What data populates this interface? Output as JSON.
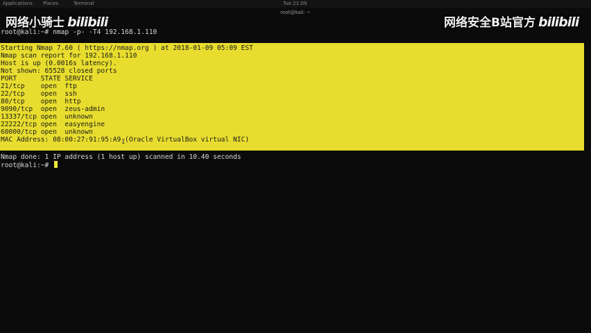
{
  "topbar": {
    "applications": "Applications",
    "places": "Places",
    "terminal": "Terminal",
    "clock": "Tue 21:09",
    "title": "root@kali: ~"
  },
  "watermarks": {
    "left_text": "网络小骑士",
    "left_logo": "bilibili",
    "right_text": "网络安全B站官方",
    "right_logo": "bilibili"
  },
  "terminal": {
    "prompt_command": "root@kali:~# nmap -p- -T4 192.168.1.110",
    "output": [
      "Starting Nmap 7.60 ( https://nmap.org ) at 2018-01-09 05:09 EST",
      "Nmap scan report for 192.168.1.110",
      "Host is up (0.0016s latency).",
      "Not shown: 65528 closed ports",
      "PORT      STATE SERVICE",
      "21/tcp    open  ftp",
      "22/tcp    open  ssh",
      "80/tcp    open  http",
      "9090/tcp  open  zeus-admin",
      "13337/tcp open  unknown",
      "22222/tcp open  easyengine",
      "60000/tcp open  unknown",
      "MAC Address: 08:00:27:91:95:A9 (Oracle VirtualBox virtual NIC)"
    ],
    "done_line": "Nmap done: 1 IP address (1 host up) scanned in 10.40 seconds",
    "final_prompt": "root@kali:~# ",
    "highlight_color": "#e8dd2e"
  }
}
